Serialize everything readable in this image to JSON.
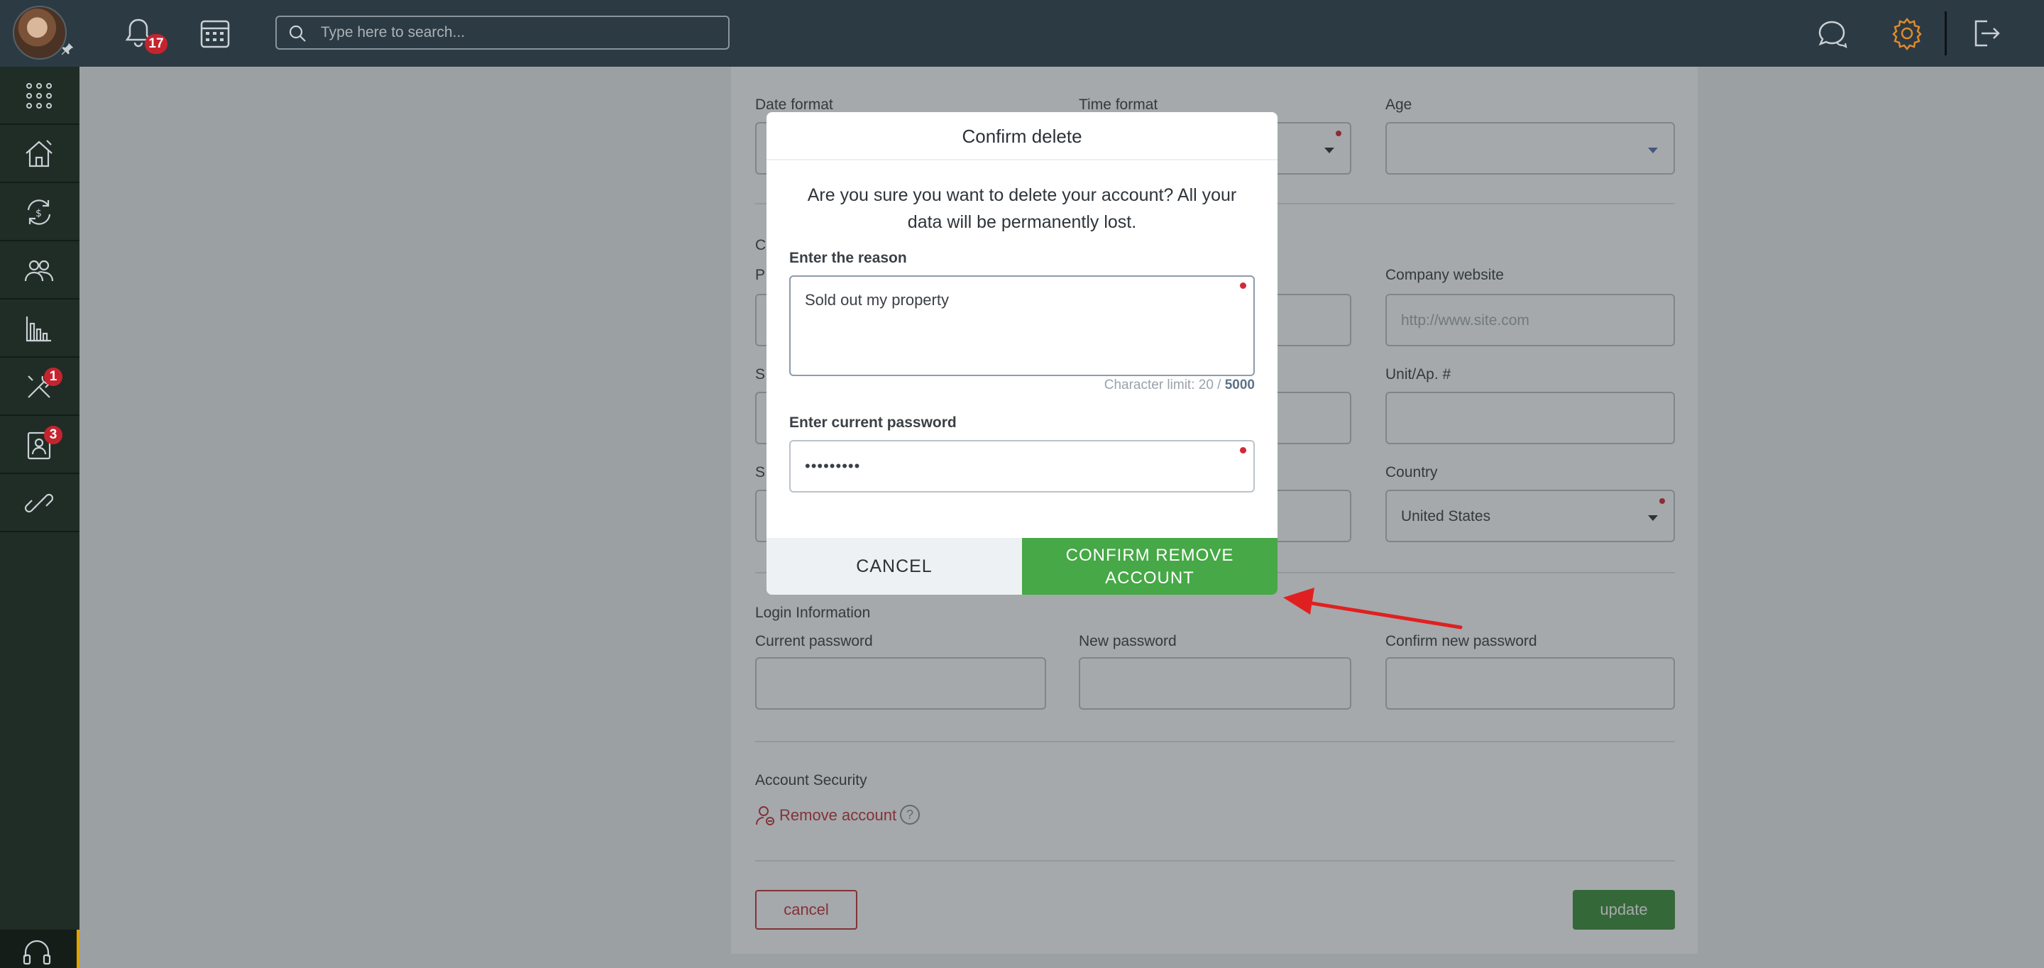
{
  "topbar": {
    "notifications_count": "17",
    "search_placeholder": "Type here to search..."
  },
  "sidebar": {
    "items": [
      {
        "icon": "apps-grid-icon"
      },
      {
        "icon": "home-icon"
      },
      {
        "icon": "transactions-icon"
      },
      {
        "icon": "users-icon"
      },
      {
        "icon": "reports-chart-icon"
      },
      {
        "icon": "tools-icon",
        "badge": "1"
      },
      {
        "icon": "contacts-icon",
        "badge": "3"
      },
      {
        "icon": "link-icon"
      }
    ],
    "bottom_icon": "headset-icon"
  },
  "form": {
    "date_format_label": "Date format",
    "time_format_label": "Time format",
    "age_label": "Age",
    "company_website_label": "Company website",
    "company_website_placeholder": "http://www.site.com",
    "unit_label": "Unit/Ap. #",
    "country_label": "Country",
    "country_value": "United States",
    "login_section": "Login Information",
    "current_password_label": "Current password",
    "new_password_label": "New password",
    "confirm_password_label": "Confirm new password",
    "security_section": "Account Security",
    "remove_account": "Remove account",
    "help": "?",
    "cancel": "cancel",
    "update": "update",
    "partial_c": "C",
    "partial_p": "P",
    "partial_s1": "S",
    "partial_s2": "S"
  },
  "modal": {
    "title": "Confirm delete",
    "message": "Are you sure you want to delete your account? All your data will be permanently lost.",
    "reason_label": "Enter the reason",
    "reason_value": "Sold out my property",
    "char_limit_text": "Character limit: 20 / ",
    "char_limit_max": "5000",
    "password_label": "Enter current password",
    "password_value": "•••••••••",
    "cancel": "CANCEL",
    "confirm": "CONFIRM REMOVE ACCOUNT"
  },
  "colors": {
    "confirm_green": "#46a846",
    "danger_red": "#c4323c",
    "topbar": "#2c3a43",
    "sidebar": "#202c26"
  }
}
